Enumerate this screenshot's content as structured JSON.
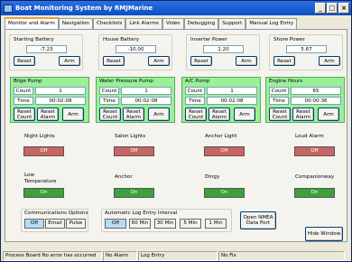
{
  "window": {
    "title": "Boat Monitoring System by RMJMarine"
  },
  "tabs": [
    {
      "label": "Monitor and Alarm",
      "active": true
    },
    {
      "label": "Navigation"
    },
    {
      "label": "Checklists"
    },
    {
      "label": "Link Alarms"
    },
    {
      "label": "Video"
    },
    {
      "label": "Debugging"
    },
    {
      "label": "Support"
    },
    {
      "label": "Manual Log Entry"
    }
  ],
  "power": [
    {
      "label": "Starting Battery",
      "value": "-7.23",
      "reset": "Reset",
      "arm": "Arm"
    },
    {
      "label": "House Battery",
      "value": "-10.00",
      "reset": "Reset",
      "arm": "Arm"
    },
    {
      "label": "Inverter Power",
      "value": "1.20",
      "reset": "Reset",
      "arm": "Arm"
    },
    {
      "label": "Shore Power",
      "value": "5.67",
      "reset": "Reset",
      "arm": "Arm"
    }
  ],
  "pumps": [
    {
      "label": "Bilge Pump",
      "count_label": "Count",
      "count": "1",
      "time_label": "Time",
      "time": "00:02:08",
      "reset_count": "Reset Count",
      "reset_alarm": "Reset Alarm",
      "arm": "Arm"
    },
    {
      "label": "Water Pressure Pump",
      "count_label": "Count",
      "count": "1",
      "time_label": "Time",
      "time": "00:02:08",
      "reset_count": "Reset Count",
      "reset_alarm": "Reset Alarm",
      "arm": "Arm"
    },
    {
      "label": "A/C Pump",
      "count_label": "Count",
      "count": "1",
      "time_label": "Time",
      "time": "00:02:08",
      "reset_count": "Reset Count",
      "reset_alarm": "Reset Alarm",
      "arm": "Arm"
    },
    {
      "label": "Engine Hours",
      "count_label": "Count",
      "count": "65",
      "time_label": "Time",
      "time": "00:00:36",
      "reset_count": "Reset Count",
      "reset_alarm": "Reset Alarm",
      "arm": "Arm"
    }
  ],
  "indicators_row1": [
    {
      "label": "Night Lights",
      "state": "Off"
    },
    {
      "label": "Salon Lights",
      "state": "Off"
    },
    {
      "label": "Anchor Light",
      "state": "Off"
    },
    {
      "label": "Loud Alarm",
      "state": "Off"
    }
  ],
  "indicators_row2": [
    {
      "label": "Low Temperature",
      "state": "On"
    },
    {
      "label": "Anchor",
      "state": "On"
    },
    {
      "label": "Dingy",
      "state": "On"
    },
    {
      "label": "Companionway",
      "state": "On"
    }
  ],
  "comm_options": {
    "label": "Communications Options",
    "options": [
      "Off",
      "Email",
      "Pulse"
    ],
    "selected": "Off"
  },
  "log_interval": {
    "label": "Automatic Log Entry Interval",
    "options": [
      "Off",
      "60 Min",
      "30 Min",
      "5 Min",
      "1 Min"
    ],
    "selected": "Off"
  },
  "nmea_button": "Open NMEA Data Port",
  "hide_button": "Hide Window",
  "status_bar": [
    "Process Board No error has occurred",
    "No Alarm",
    "Log Entry",
    "No Fix"
  ],
  "colors": {
    "off": "#c86464",
    "on": "#3ca03c",
    "pump_panel": "#98f098",
    "title_bar": "#0b4fc6"
  }
}
